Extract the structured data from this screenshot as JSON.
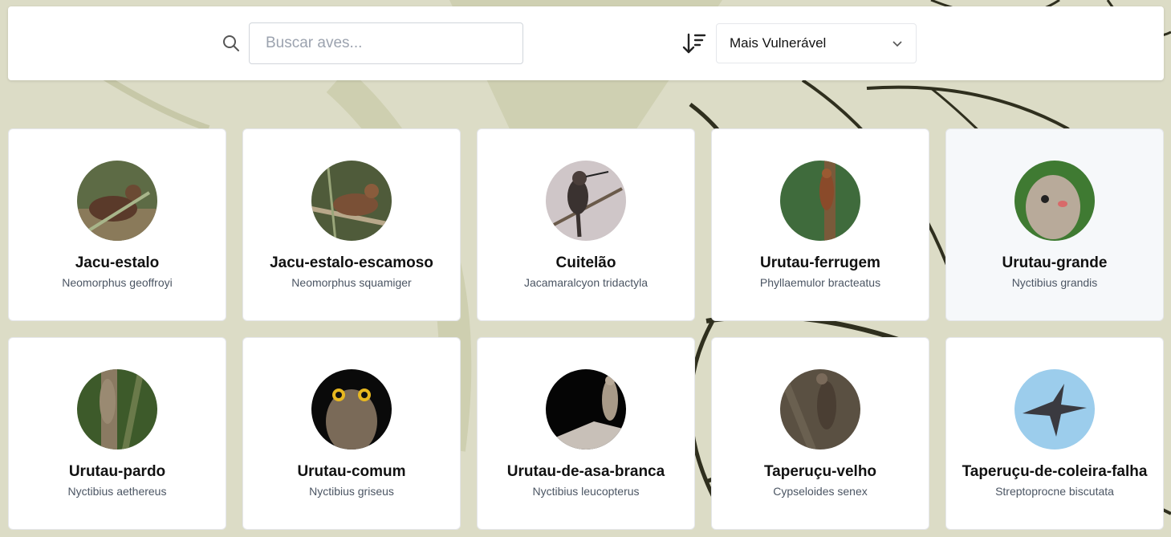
{
  "search": {
    "placeholder": "Buscar aves..."
  },
  "sort": {
    "selected": "Mais Vulnerável"
  },
  "colors": {
    "background": "#dcdcc6",
    "card": "#ffffff",
    "card_hover": "#f6f8fa",
    "leaf_outline": "#2f2f1e"
  },
  "birds": [
    {
      "name": "Jacu-estalo",
      "scientific": "Neomorphus geoffroyi"
    },
    {
      "name": "Jacu-estalo-escamoso",
      "scientific": "Neomorphus squamiger"
    },
    {
      "name": "Cuitelão",
      "scientific": "Jacamaralcyon tridactyla"
    },
    {
      "name": "Urutau-ferrugem",
      "scientific": "Phyllaemulor bracteatus"
    },
    {
      "name": "Urutau-grande",
      "scientific": "Nyctibius grandis"
    },
    {
      "name": "Urutau-pardo",
      "scientific": "Nyctibius aethereus"
    },
    {
      "name": "Urutau-comum",
      "scientific": "Nyctibius griseus"
    },
    {
      "name": "Urutau-de-asa-branca",
      "scientific": "Nyctibius leucopterus"
    },
    {
      "name": "Taperuçu-velho",
      "scientific": "Cypseloides senex"
    },
    {
      "name": "Taperuçu-de-coleira-falha",
      "scientific": "Streptoprocne biscutata"
    }
  ]
}
